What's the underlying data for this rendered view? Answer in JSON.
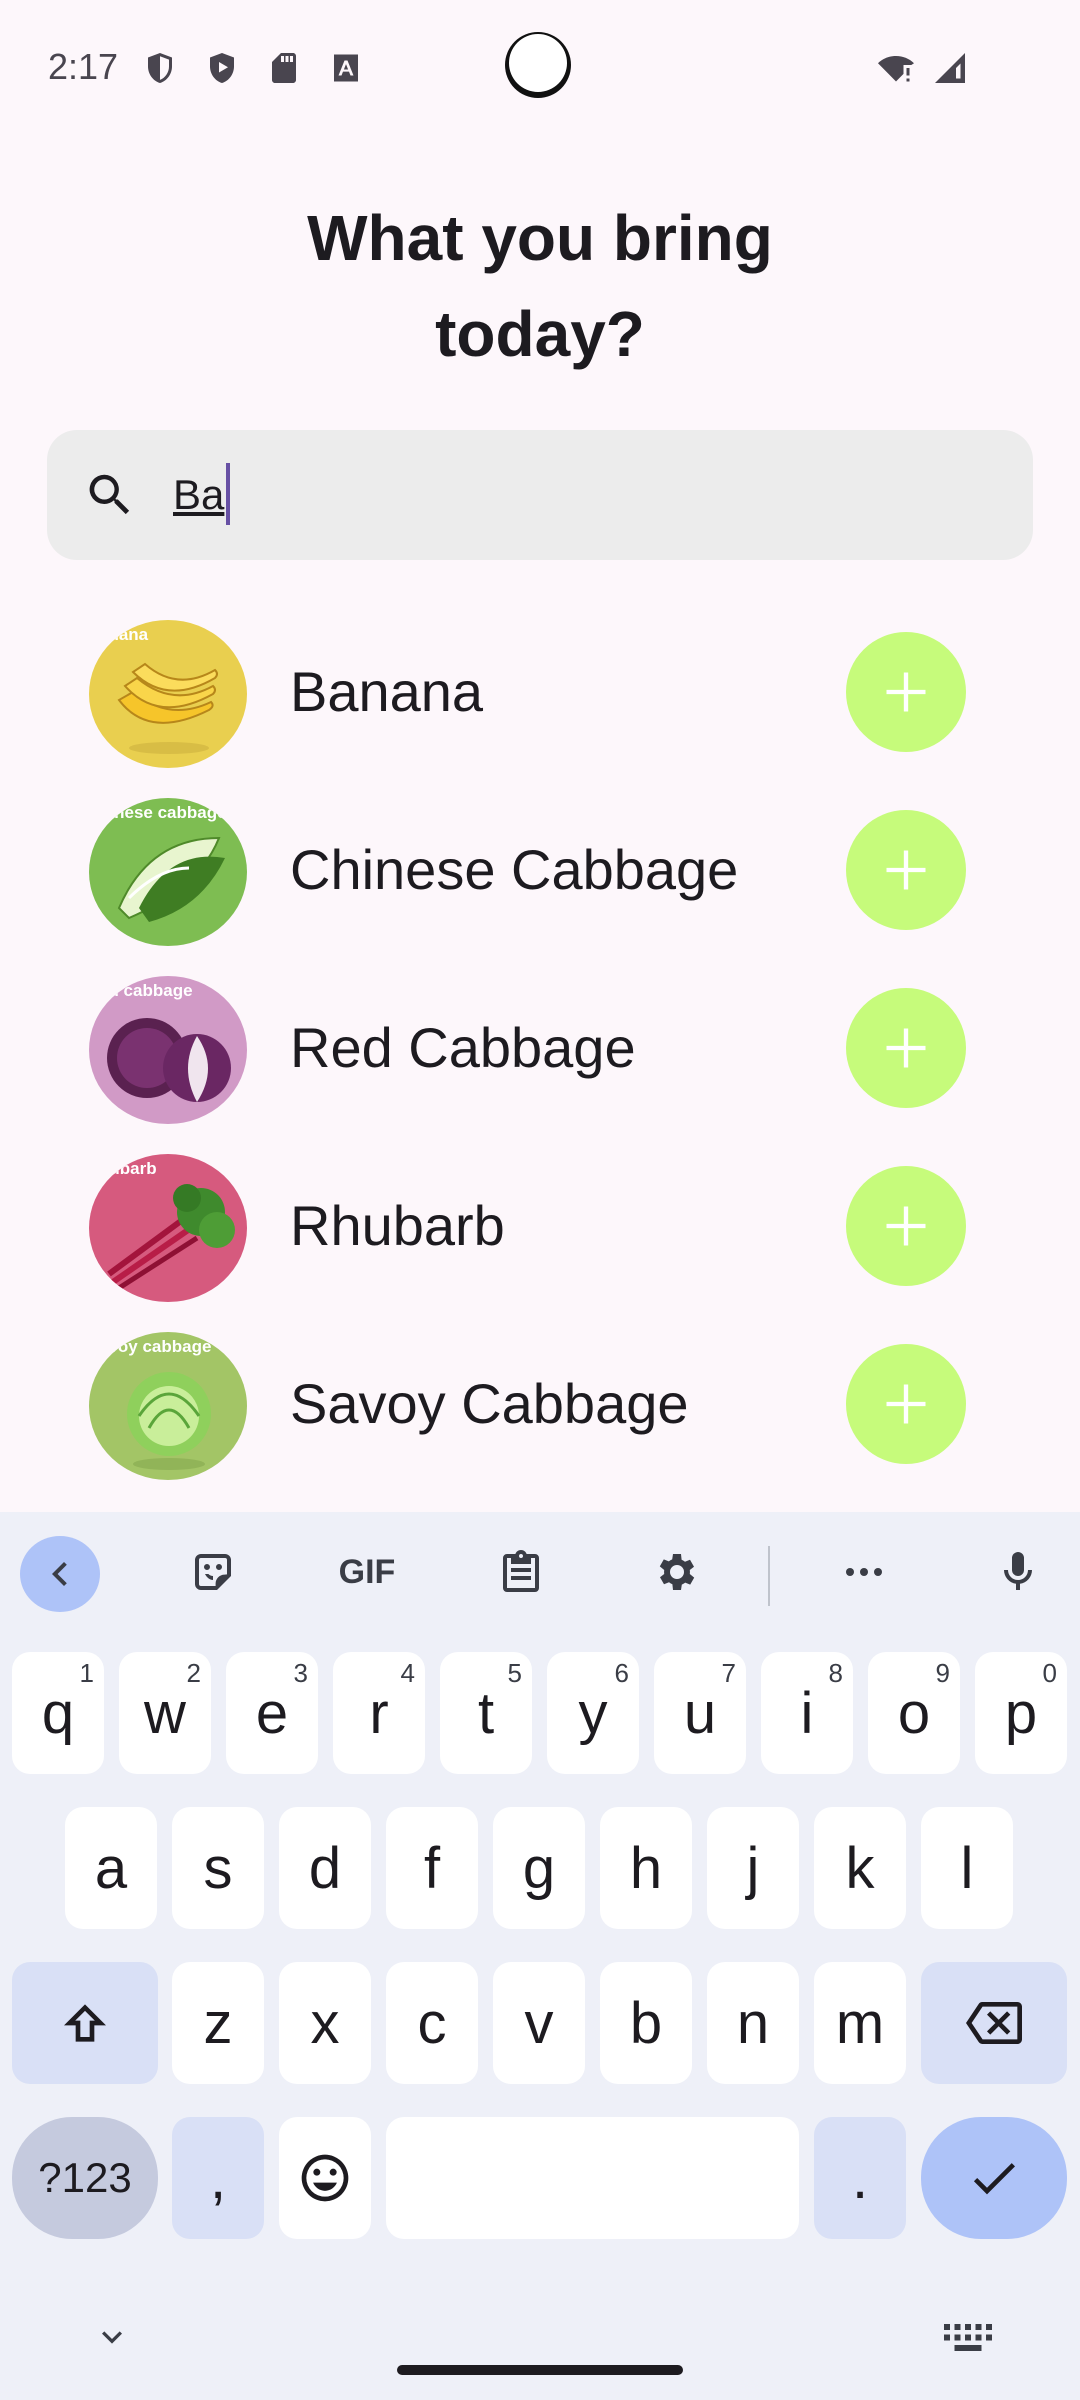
{
  "status": {
    "time": "2:17"
  },
  "title_lines": [
    "What you bring",
    "today?"
  ],
  "search": {
    "value": "Ba"
  },
  "items": [
    {
      "name": "Banana",
      "tag": "anana",
      "color": "#e9cf4f"
    },
    {
      "name": "Chinese Cabbage",
      "tag": "hinese cabbage",
      "color": "#7ebd52"
    },
    {
      "name": "Red Cabbage",
      "tag": "ed cabbage",
      "color": "#d19ac6"
    },
    {
      "name": "Rhubarb",
      "tag": "hubarb",
      "color": "#d65a7e"
    },
    {
      "name": "Savoy Cabbage",
      "tag": "avoy cabbage",
      "color": "#a3c566"
    }
  ],
  "keyboard": {
    "toolbar": {
      "gif": "GIF"
    },
    "row1": [
      {
        "k": "q",
        "h": "1"
      },
      {
        "k": "w",
        "h": "2"
      },
      {
        "k": "e",
        "h": "3"
      },
      {
        "k": "r",
        "h": "4"
      },
      {
        "k": "t",
        "h": "5"
      },
      {
        "k": "y",
        "h": "6"
      },
      {
        "k": "u",
        "h": "7"
      },
      {
        "k": "i",
        "h": "8"
      },
      {
        "k": "o",
        "h": "9"
      },
      {
        "k": "p",
        "h": "0"
      }
    ],
    "row2": [
      "a",
      "s",
      "d",
      "f",
      "g",
      "h",
      "j",
      "k",
      "l"
    ],
    "row3": [
      "z",
      "x",
      "c",
      "v",
      "b",
      "n",
      "m"
    ],
    "sym": "?123",
    "comma": ",",
    "period": "."
  },
  "colors": {
    "add_button": "#c6fb7b",
    "accent": "#6750a4",
    "keyboard_bg": "#eef0f8"
  }
}
